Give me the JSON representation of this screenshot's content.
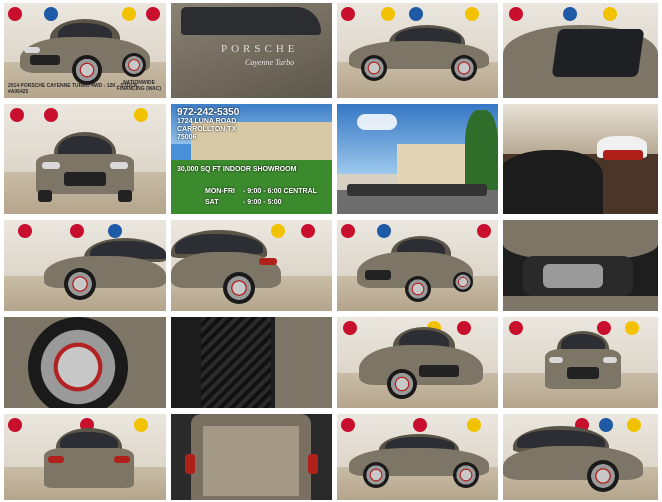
{
  "thumbnails": [
    {
      "id": "photo-1",
      "caption_left": "2014 PORSCHE CAYENNE TURBO 4WD - 12K - STOCK #A06425",
      "caption_right": "NATIONWIDE FINANCING (WAC)"
    },
    {
      "id": "photo-2",
      "badge_text": "PORSCHE",
      "badge_subtext": "Cayenne Turbo"
    },
    {
      "id": "photo-3"
    },
    {
      "id": "photo-4"
    },
    {
      "id": "photo-5"
    },
    {
      "id": "photo-6",
      "phone": "972-242-5350",
      "address_line1": "1724 LUNA ROAD",
      "address_line2": "CARROLLTON TX",
      "zip": "75006",
      "showroom": "30,000 SQ FT INDOOR SHOWROOM",
      "hours_row1_label": "MON-FRI",
      "hours_row1_value": "- 9:00 - 6:00 CENTRAL",
      "hours_row2_label": "SAT",
      "hours_row2_value": "- 9:00 - 5:00"
    },
    {
      "id": "photo-7"
    },
    {
      "id": "photo-8"
    },
    {
      "id": "photo-9"
    },
    {
      "id": "photo-10"
    },
    {
      "id": "photo-11"
    },
    {
      "id": "photo-12"
    },
    {
      "id": "photo-13"
    },
    {
      "id": "photo-14"
    },
    {
      "id": "photo-15"
    },
    {
      "id": "photo-16"
    },
    {
      "id": "photo-17"
    },
    {
      "id": "photo-18"
    },
    {
      "id": "photo-19"
    },
    {
      "id": "photo-20"
    }
  ],
  "colors": {
    "car_body": "#7d7565",
    "wall": "#ebe7df",
    "floor": "#b4a58c",
    "sky": "#4a8fd9",
    "grass": "#3c8a2e"
  }
}
